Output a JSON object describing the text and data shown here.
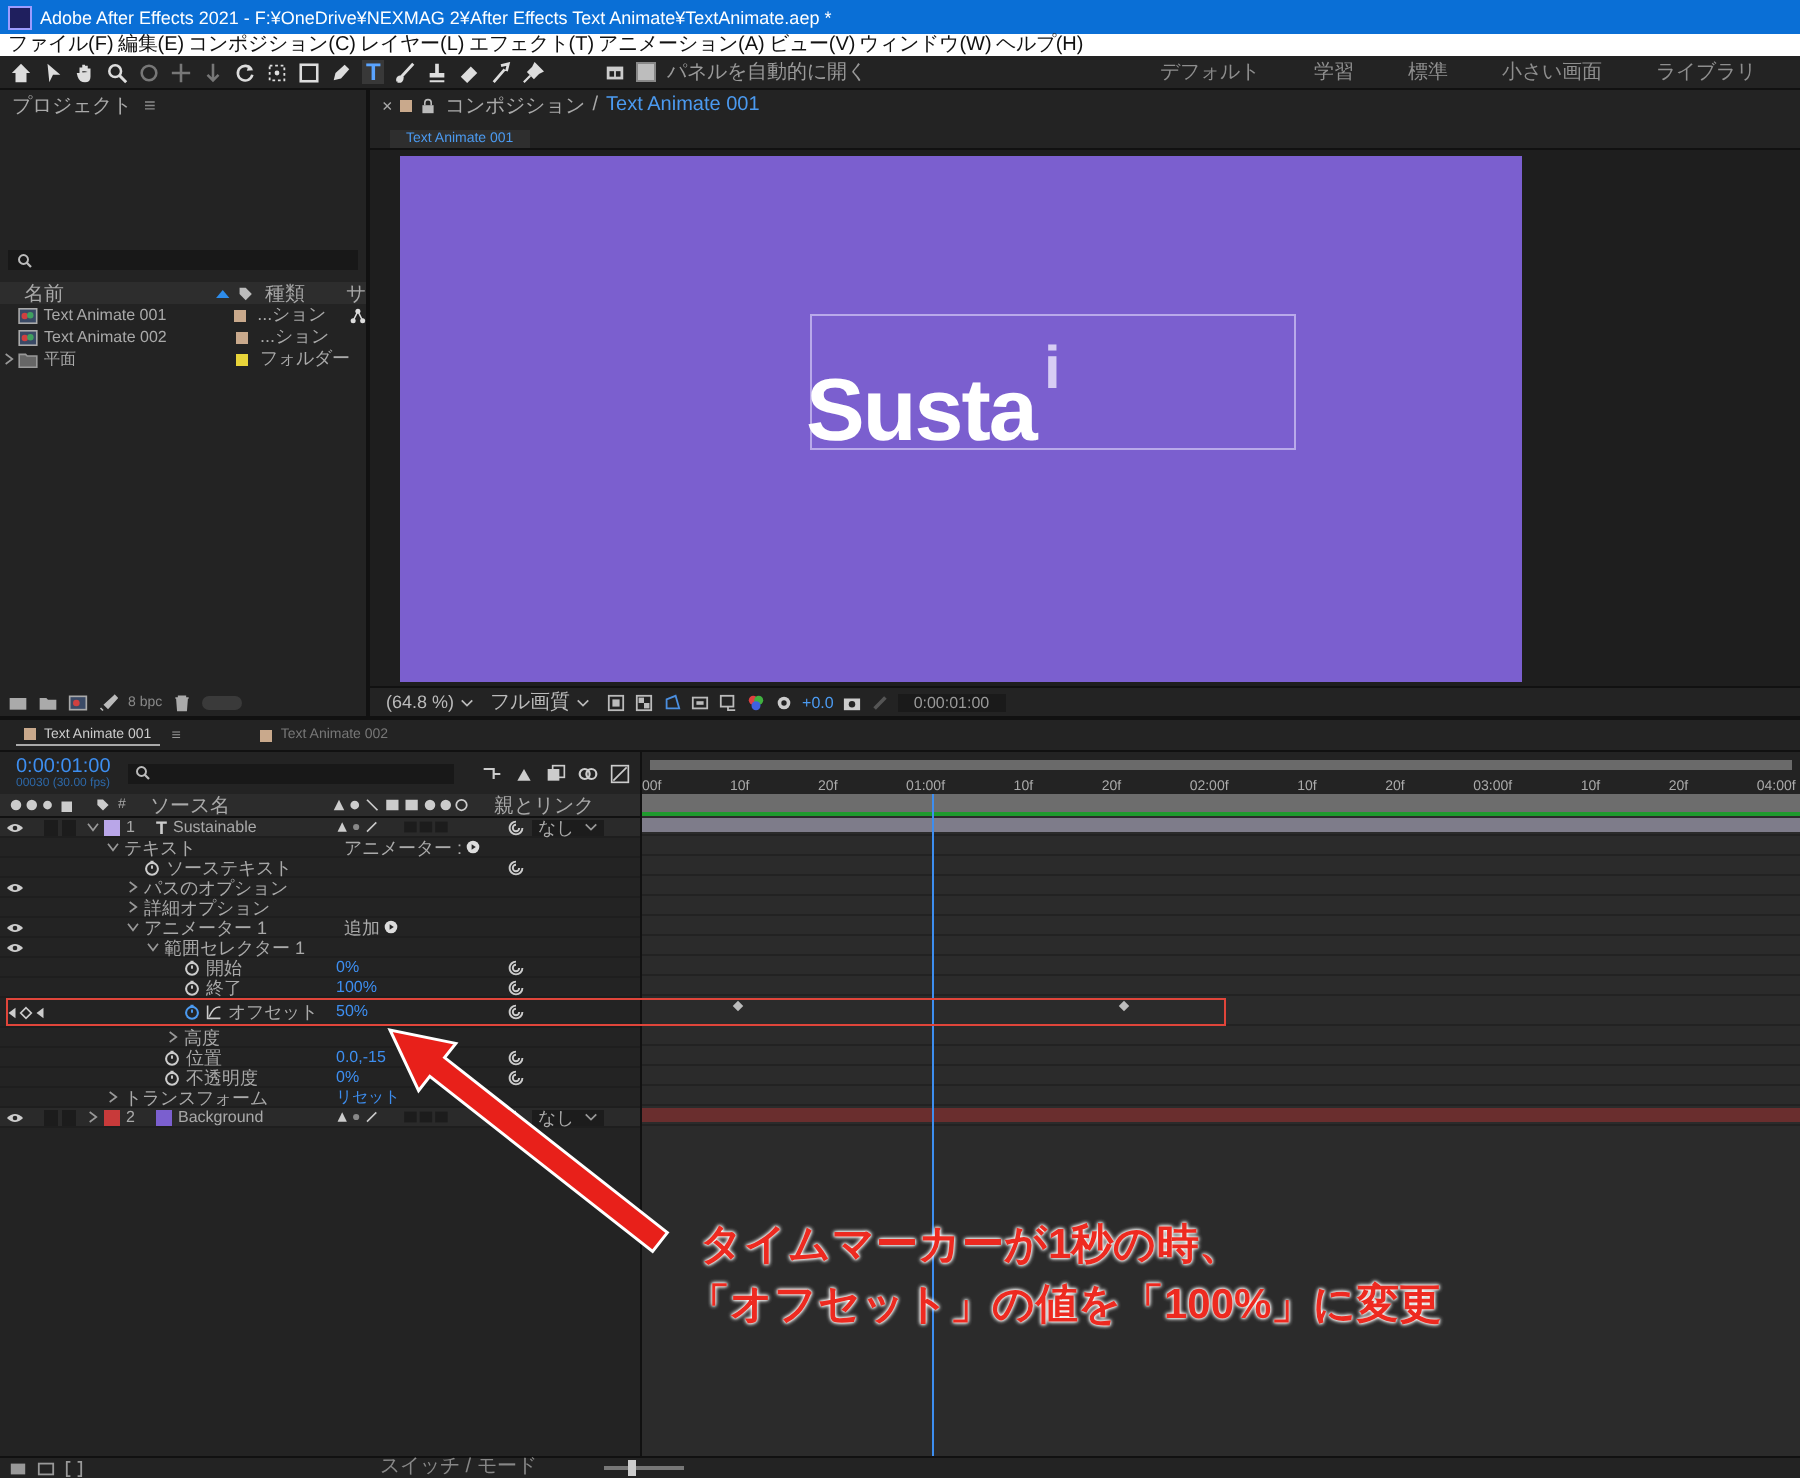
{
  "window": {
    "title": "Adobe After Effects 2021 - F:¥OneDrive¥NEXMAG 2¥After Effects Text Animate¥TextAnimate.aep *"
  },
  "menu": [
    "ファイル(F)",
    "編集(E)",
    "コンポジション(C)",
    "レイヤー(L)",
    "エフェクト(T)",
    "アニメーション(A)",
    "ビュー(V)",
    "ウィンドウ(W)",
    "ヘルプ(H)"
  ],
  "toolbar": {
    "type_tool": "T",
    "auto_open": {
      "label": "パネルを自動的に開く",
      "checked": true
    }
  },
  "workspaces": [
    "デフォルト",
    "学習",
    "標準",
    "小さい画面",
    "ライブラリ"
  ],
  "project": {
    "title": "プロジェクト",
    "menu": "≡",
    "columns": [
      "名前",
      "種類",
      "サ"
    ],
    "items": [
      {
        "name": "Text Animate 001",
        "type": "...ション",
        "kind": "comp",
        "color": "#c9a98c",
        "flowchart": true
      },
      {
        "name": "Text Animate 002",
        "type": "...ション",
        "kind": "comp",
        "color": "#c9a98c",
        "flowchart": false
      },
      {
        "name": "平面",
        "type": "フォルダー",
        "kind": "folder",
        "color": "#e8d43a",
        "expanded": false,
        "flowchart": false
      }
    ],
    "bit_depth": "8 bpc"
  },
  "composition": {
    "close": "×",
    "separator": "/",
    "panel_title": "コンポジション",
    "comp_name": "Text Animate 001",
    "viewer_tab": "Text Animate 001",
    "canvas_text": "Susta",
    "raised_char": "i",
    "zoom": "(64.8 %)",
    "quality": "フル画質",
    "exposure": "+0.0",
    "timecode": "0:00:01:00"
  },
  "timeline": {
    "tabs": [
      {
        "label": "Text Animate 001",
        "selected": true
      },
      {
        "label": "Text Animate 002",
        "selected": false
      }
    ],
    "tab_menu": "≡",
    "timecode": "0:00:01:00",
    "frame": "00030 (30.00 fps)",
    "columns": [
      "#",
      "ソース名",
      "親とリンク"
    ],
    "ruler": [
      "00f",
      "10f",
      "20f",
      "01:00f",
      "10f",
      "20f",
      "02:00f",
      "10f",
      "20f",
      "03:00f",
      "10f",
      "20f",
      "04:00f"
    ],
    "cti": {
      "level": 0.25
    },
    "zoom": {
      "level": 0.35
    },
    "layers": [
      {
        "number": "1",
        "name": "Sustainable",
        "kind": "text",
        "glyph": "T",
        "color": "#b9a6e8",
        "visible": true,
        "solo": false,
        "locked": false,
        "expanded": true,
        "parent": "なし",
        "children": [
          {
            "name": "テキスト",
            "expanded": true,
            "action": "アニメーター :",
            "children": [
              {
                "name": "ソーステキスト",
                "keyframed": false
              },
              {
                "name": "パスのオプション",
                "expanded": false,
                "visible": true
              },
              {
                "name": "詳細オプション",
                "expanded": false
              },
              {
                "name": "アニメーター 1",
                "expanded": true,
                "visible": true,
                "action": "追加",
                "children": [
                  {
                    "name": "範囲セレクター 1",
                    "expanded": true,
                    "visible": true,
                    "children": [
                      {
                        "name": "開始",
                        "keyframed": false,
                        "value": "0%"
                      },
                      {
                        "name": "終了",
                        "keyframed": false,
                        "value": "100%"
                      },
                      {
                        "name": "オフセット",
                        "keyframed": true,
                        "graph": true,
                        "value": "50%",
                        "keyframes": [
                          {
                            "level": 0.083
                          },
                          {
                            "level": 0.417
                          }
                        ]
                      },
                      {
                        "name": "高度",
                        "expanded": false
                      }
                    ]
                  },
                  {
                    "name": "位置",
                    "keyframed": false,
                    "value": "0.0,-15"
                  },
                  {
                    "name": "不透明度",
                    "keyframed": false,
                    "value": "0%"
                  }
                ]
              }
            ]
          },
          {
            "name": "トランスフォーム",
            "expanded": false,
            "value": "リセット"
          }
        ]
      },
      {
        "number": "2",
        "name": "Background",
        "kind": "solid",
        "color": "#c83a3a",
        "visible": true,
        "solo": false,
        "locked": false,
        "expanded": false,
        "parent": "なし"
      }
    ],
    "footer": "スイッチ / モード"
  },
  "annotation": {
    "lines": [
      "タイムマーカーが1秒の時、",
      "「オフセット」の値を「100%」に変更"
    ]
  }
}
